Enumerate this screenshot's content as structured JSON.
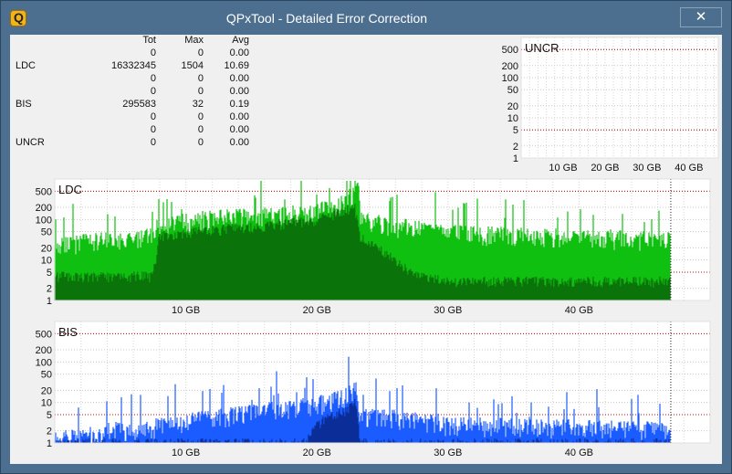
{
  "window": {
    "title": "QPxTool - Detailed Error Correction",
    "close_glyph": "✕",
    "app_icon_letter": "Q"
  },
  "stats": {
    "headers": [
      "",
      "Tot",
      "Max",
      "Avg"
    ],
    "rows": [
      [
        "",
        "0",
        "0",
        "0.00"
      ],
      [
        "LDC",
        "16332345",
        "1504",
        "10.69"
      ],
      [
        "",
        "0",
        "0",
        "0.00"
      ],
      [
        "",
        "0",
        "0",
        "0.00"
      ],
      [
        "BIS",
        "295583",
        "32",
        "0.19"
      ],
      [
        "",
        "0",
        "0",
        "0.00"
      ],
      [
        "",
        "0",
        "0",
        "0.00"
      ],
      [
        "UNCR",
        "0",
        "0",
        "0.00"
      ]
    ]
  },
  "chart_data": [
    {
      "type": "area",
      "name": "UNCR",
      "title": "UNCR",
      "scale": "log",
      "ylim": [
        1,
        1000
      ],
      "yticks": [
        500,
        200,
        100,
        50,
        20,
        10,
        5,
        2,
        1
      ],
      "xlim": [
        0,
        47
      ],
      "xticks": [
        "10 GB",
        "20 GB",
        "30 GB",
        "40 GB"
      ],
      "xtick_values": [
        10,
        20,
        30,
        40
      ],
      "thresholds": [
        5,
        500
      ],
      "color": "#d40000",
      "values": []
    },
    {
      "type": "area",
      "name": "LDC",
      "title": "LDC",
      "scale": "log",
      "ylim": [
        1,
        1000
      ],
      "yticks": [
        500,
        200,
        100,
        50,
        20,
        10,
        5,
        2,
        1
      ],
      "xlim": [
        0,
        50
      ],
      "xticks": [
        "10 GB",
        "20 GB",
        "30 GB",
        "40 GB"
      ],
      "xtick_values": [
        10,
        20,
        30,
        40
      ],
      "thresholds": [
        5,
        500
      ],
      "end": 47,
      "color": "#11c011",
      "color_avg": "#0a6e0a",
      "envelope": [
        [
          0,
          30
        ],
        [
          2,
          40
        ],
        [
          4,
          45
        ],
        [
          6,
          45
        ],
        [
          7.5,
          60
        ],
        [
          8,
          120
        ],
        [
          10,
          130
        ],
        [
          12,
          160
        ],
        [
          14,
          180
        ],
        [
          16,
          180
        ],
        [
          18,
          200
        ],
        [
          20,
          240
        ],
        [
          22,
          400
        ],
        [
          23.2,
          800
        ],
        [
          23.3,
          150
        ],
        [
          26,
          100
        ],
        [
          28,
          90
        ],
        [
          30,
          70
        ],
        [
          34,
          60
        ],
        [
          38,
          55
        ],
        [
          42,
          50
        ],
        [
          47,
          45
        ]
      ],
      "avg": [
        [
          0,
          4
        ],
        [
          7.5,
          4
        ],
        [
          8,
          40
        ],
        [
          12,
          55
        ],
        [
          16,
          70
        ],
        [
          20,
          100
        ],
        [
          22.9,
          200
        ],
        [
          23.3,
          40
        ],
        [
          26,
          10
        ],
        [
          27.5,
          4
        ],
        [
          30,
          3
        ],
        [
          40,
          3
        ],
        [
          47,
          3
        ]
      ]
    },
    {
      "type": "area",
      "name": "BIS",
      "title": "BIS",
      "scale": "log",
      "ylim": [
        1,
        1000
      ],
      "yticks": [
        500,
        200,
        100,
        50,
        20,
        10,
        5,
        2,
        1
      ],
      "xlim": [
        0,
        50
      ],
      "xticks": [
        "10 GB",
        "20 GB",
        "30 GB",
        "40 GB"
      ],
      "xtick_values": [
        10,
        20,
        30,
        40
      ],
      "thresholds": [
        5,
        500
      ],
      "end": 47,
      "color": "#1a5cff",
      "color_avg": "#0a2a90",
      "envelope": [
        [
          0,
          2
        ],
        [
          3.5,
          2
        ],
        [
          4,
          3
        ],
        [
          7,
          3
        ],
        [
          8,
          4
        ],
        [
          12,
          6
        ],
        [
          16,
          9
        ],
        [
          20,
          13
        ],
        [
          22,
          20
        ],
        [
          23,
          32
        ],
        [
          23.3,
          7
        ],
        [
          26,
          6
        ],
        [
          30,
          4
        ],
        [
          40,
          3.5
        ],
        [
          47,
          3
        ]
      ],
      "avg": [
        [
          0,
          1
        ],
        [
          19,
          1
        ],
        [
          20,
          3
        ],
        [
          22,
          6
        ],
        [
          23,
          10
        ],
        [
          23.3,
          1
        ],
        [
          47,
          1
        ]
      ]
    }
  ]
}
